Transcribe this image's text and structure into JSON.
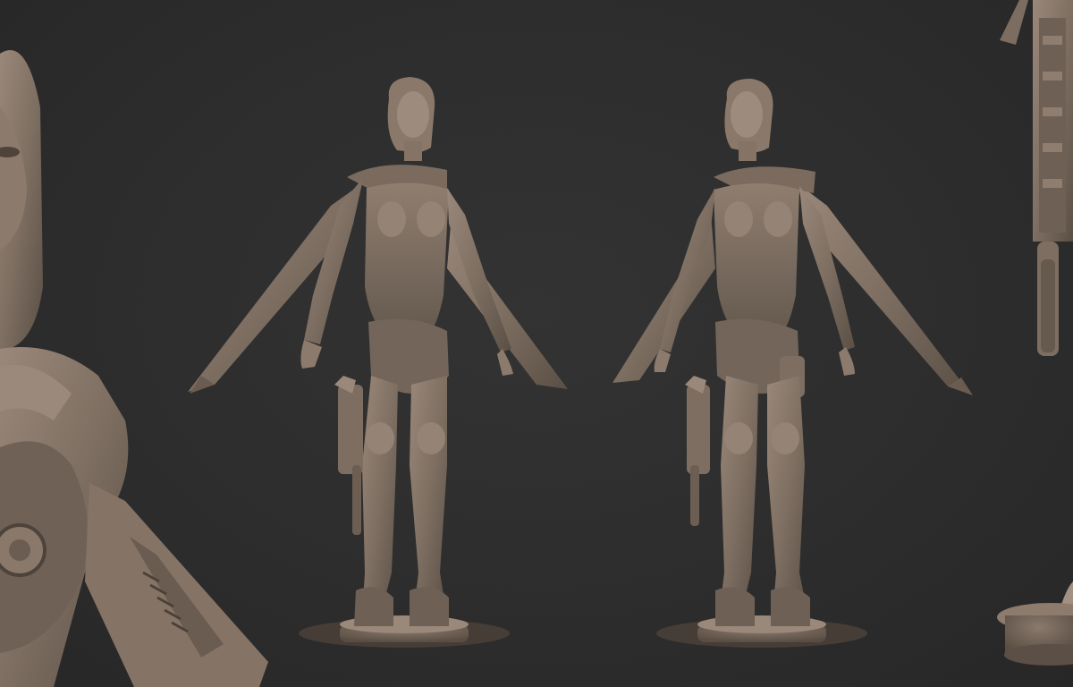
{
  "scene": {
    "background_color": "#2c2c2c",
    "clay_color": "#7e6f62",
    "clay_shadow_color": "#5b4f45",
    "clay_highlight_color": "#a89585",
    "panels": [
      {
        "view": "closeup-left",
        "subject": "sculpt-face-and-torso-detail"
      },
      {
        "view": "front-three-quarter-left",
        "subject": "armored-female-figure-on-base"
      },
      {
        "view": "front-three-quarter-right",
        "subject": "armored-female-figure-on-base"
      },
      {
        "view": "closeup-right",
        "subject": "holstered-pistol-and-base-detail"
      }
    ]
  }
}
